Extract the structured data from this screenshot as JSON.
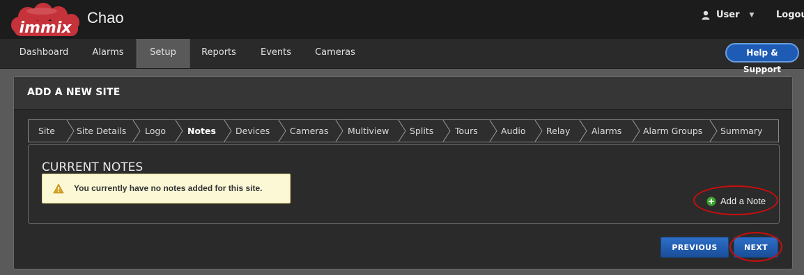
{
  "header": {
    "logo_text": "immix",
    "app_title": "Chao",
    "user_label": "User",
    "logout_label": "Logout"
  },
  "nav": {
    "items": [
      "Dashboard",
      "Alarms",
      "Setup",
      "Reports",
      "Events",
      "Cameras"
    ],
    "active": "Setup",
    "help_label": "Help & Support"
  },
  "panel": {
    "title": "ADD A NEW SITE",
    "steps": [
      "Site",
      "Site Details",
      "Logo",
      "Notes",
      "Devices",
      "Cameras",
      "Multiview",
      "Splits",
      "Tours",
      "Audio",
      "Relay",
      "Alarms",
      "Alarm Groups",
      "Summary"
    ],
    "current_step": "Notes",
    "notes_heading": "CURRENT NOTES",
    "alert_text": "You currently have no notes added for this site.",
    "add_note_label": "Add a Note",
    "previous_label": "PREVIOUS",
    "next_label": "NEXT"
  },
  "icons": {
    "user": "user-icon",
    "dropdown": "caret-down-icon",
    "warning": "warning-icon",
    "add": "plus-circle-icon"
  },
  "colors": {
    "accent_blue": "#1e5bb5",
    "annotation_red": "#c80e0e",
    "alert_bg": "#fcf8d6",
    "logo_red": "#c5323a"
  }
}
